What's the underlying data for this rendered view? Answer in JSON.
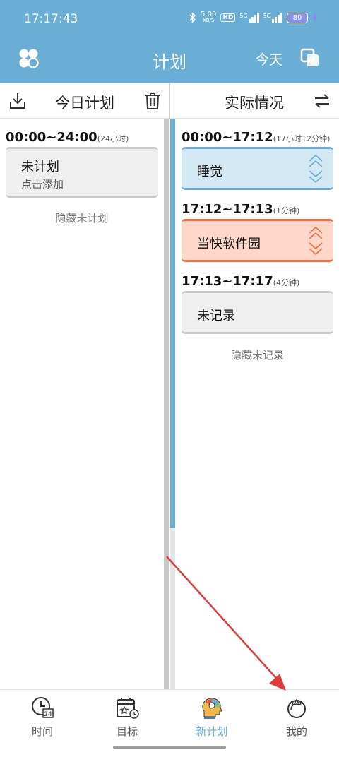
{
  "status_bar": {
    "time": "17:17:43",
    "net_speed_value": "5.00",
    "net_speed_unit": "KB/S",
    "hd_badge": "HD",
    "signal1": "5G",
    "signal2": "5G",
    "battery": "80"
  },
  "app_bar": {
    "title": "计划",
    "today_label": "今天"
  },
  "toolbar": {
    "plan_title": "今日计划",
    "actual_title": "实际情况"
  },
  "plan_column": {
    "time_range": "00:00~24:00",
    "duration": "(24小时)",
    "card_label": "未计划",
    "card_sub": "点击添加",
    "hint": "隐藏未计划"
  },
  "actual_column": {
    "entries": [
      {
        "time_range": "00:00~17:12",
        "duration": "(17小时12分钟)",
        "label": "睡觉",
        "color": "#6aaed6"
      },
      {
        "time_range": "17:12~17:13",
        "duration": "(1分钟)",
        "label": "当快软件园",
        "color": "#f36f3c"
      },
      {
        "time_range": "17:13~17:17",
        "duration": "(4分钟)",
        "label": "未记录",
        "color": "#c9c9c9"
      }
    ],
    "hint": "隐藏未记录"
  },
  "bottom_nav": {
    "items": [
      {
        "label": "时间",
        "icon": "clock-24-icon"
      },
      {
        "label": "目标",
        "icon": "calendar-star-icon"
      },
      {
        "label": "新计划",
        "icon": "head-bulb-icon"
      },
      {
        "label": "我的",
        "icon": "tomato-icon"
      }
    ],
    "active_index": 2
  },
  "colors": {
    "primary": "#6aaed6",
    "accent_orange": "#f36f3c",
    "annotation_red": "#e03c3c"
  }
}
